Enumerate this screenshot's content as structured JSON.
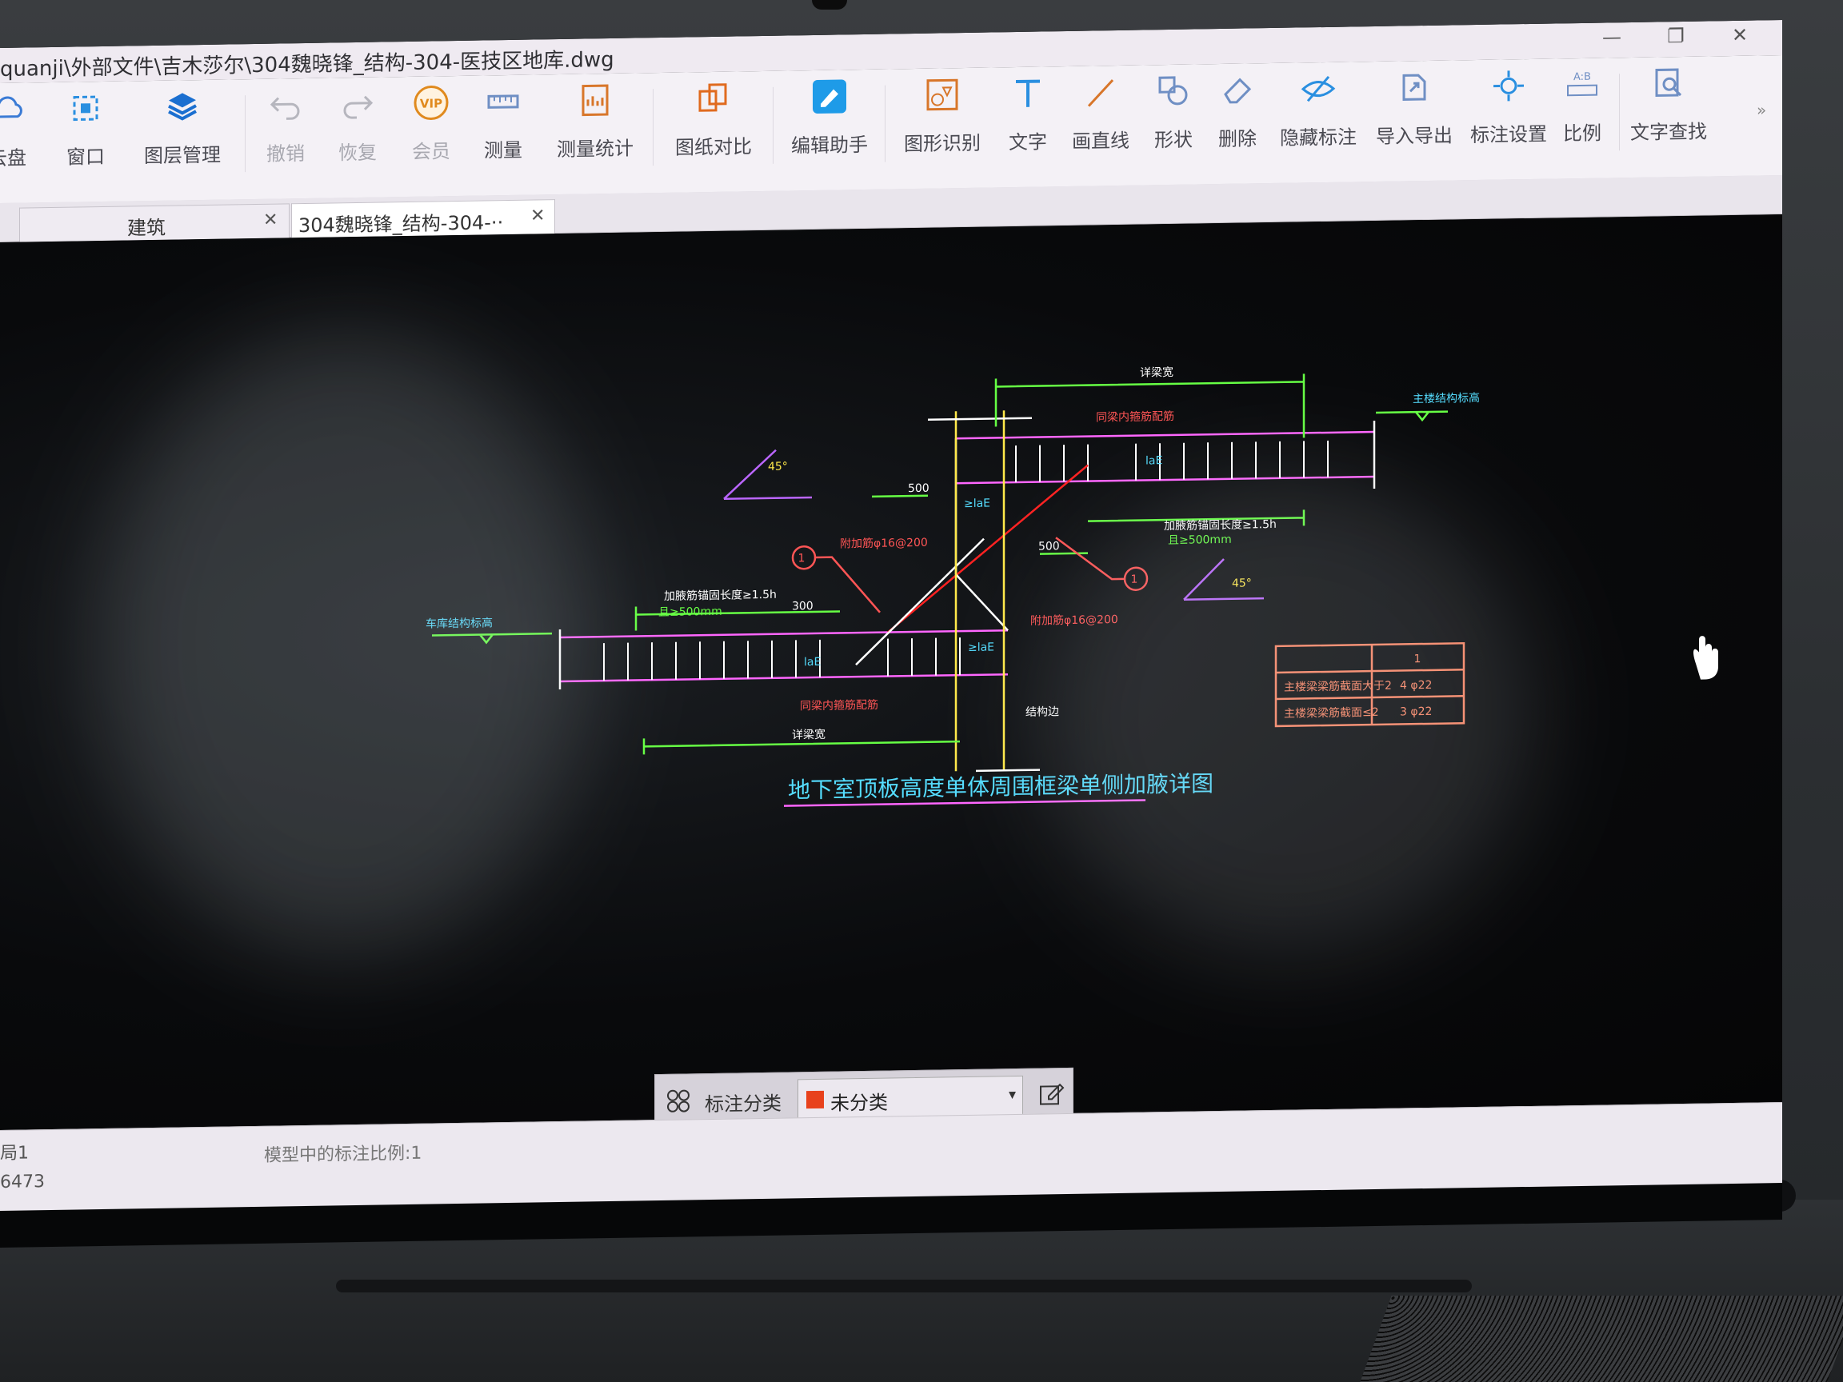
{
  "window": {
    "title": "quanji\\外部文件\\吉木莎尔\\304魏晓锋_结构-304-医技区地库.dwg",
    "minimize": "—",
    "restore": "❐",
    "close": "✕"
  },
  "toolbar": [
    {
      "id": "disk",
      "label": "云盘",
      "icon": "cloud-icon",
      "dim": false
    },
    {
      "id": "window",
      "label": "窗口",
      "icon": "window-icon",
      "dim": false
    },
    {
      "id": "layers",
      "label": "图层管理",
      "icon": "layers-icon",
      "dim": false
    },
    {
      "id": "undo",
      "label": "撤销",
      "icon": "undo-icon",
      "dim": true
    },
    {
      "id": "redo",
      "label": "恢复",
      "icon": "redo-icon",
      "dim": true
    },
    {
      "id": "vip",
      "label": "会员",
      "icon": "vip-icon",
      "dim": true
    },
    {
      "id": "measure",
      "label": "测量",
      "icon": "ruler-icon",
      "dim": false
    },
    {
      "id": "measure-stats",
      "label": "测量统计",
      "icon": "measure-stats-icon",
      "dim": false
    },
    {
      "id": "compare",
      "label": "图纸对比",
      "icon": "compare-icon",
      "dim": false
    },
    {
      "id": "edit-helper",
      "label": "编辑助手",
      "icon": "edit-helper-icon",
      "dim": false
    },
    {
      "id": "shape-recog",
      "label": "图形识别",
      "icon": "shape-recognize-icon",
      "dim": false
    },
    {
      "id": "text",
      "label": "文字",
      "icon": "text-icon",
      "dim": false
    },
    {
      "id": "line",
      "label": "画直线",
      "icon": "line-icon",
      "dim": false
    },
    {
      "id": "shape",
      "label": "形状",
      "icon": "shapes-icon",
      "dim": false
    },
    {
      "id": "delete",
      "label": "删除",
      "icon": "eraser-icon",
      "dim": false
    },
    {
      "id": "hide-marks",
      "label": "隐藏标注",
      "icon": "hide-icon",
      "dim": false
    },
    {
      "id": "import-export",
      "label": "导入导出",
      "icon": "import-export-icon",
      "dim": false
    },
    {
      "id": "mark-settings",
      "label": "标注设置",
      "icon": "settings-icon",
      "dim": false
    },
    {
      "id": "scale",
      "label": "比例",
      "icon": "scale-icon",
      "dim": false
    },
    {
      "id": "find-text",
      "label": "文字查找",
      "icon": "search-icon",
      "dim": false
    }
  ],
  "more_tools": "»",
  "tabs": [
    {
      "label": "建筑",
      "close": "✕",
      "active": false
    },
    {
      "label": "304魏晓锋_结构-304-··",
      "close": "✕",
      "active": true
    }
  ],
  "drawing": {
    "title": "地下室顶板高度单体周围框梁单侧加腋详图",
    "angle_mark": "45°",
    "dim_500": "500",
    "dim_300": "300",
    "callout": "1",
    "note_rebar": "附加筋φ16@200",
    "note_ge_15h": "加腋筋锚固长度≥1.5h",
    "note_ge_500": "且≥500mm",
    "note_laE": "≥laE",
    "note_laE_short": "laE",
    "note_top_elev": "主楼结构标高",
    "note_low_elev": "车库结构标高",
    "note_same_as_beam": "同梁内箍筋配筋",
    "note_beam_width": "详梁宽",
    "note_edge": "结构边",
    "table": {
      "header": "1",
      "rows": [
        {
          "name": "主楼梁梁筋截面大于2",
          "value": "4 φ22"
        },
        {
          "name": "主楼梁梁筋截面≤2",
          "value": "3 φ22"
        }
      ]
    }
  },
  "label_bar": {
    "title": "标注分类",
    "selected": "未分类",
    "swatch_color": "#e8411c",
    "caret": "▾"
  },
  "status": {
    "layout": "局1",
    "scale_text": "模型中的标注比例:1",
    "coord": "6473"
  }
}
